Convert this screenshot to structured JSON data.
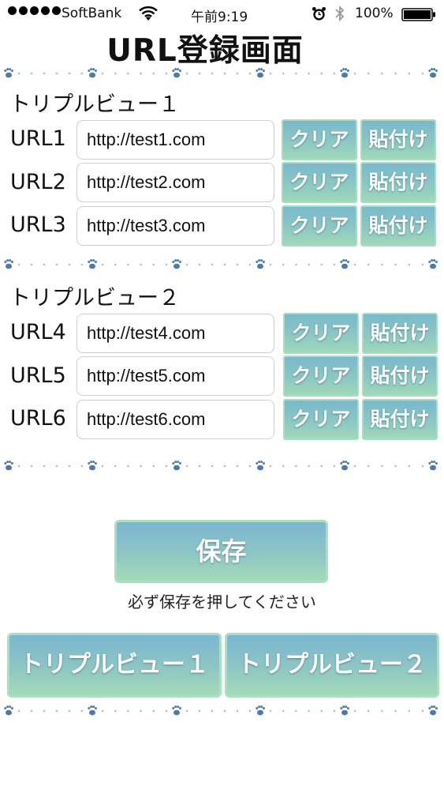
{
  "status_bar": {
    "carrier": "SoftBank",
    "time": "午前9:19",
    "battery_percent": "100%",
    "signal_bars": 5,
    "icons": [
      "wifi-icon",
      "alarm-icon",
      "bluetooth-icon",
      "battery-icon"
    ]
  },
  "page": {
    "title": "URL登録画面"
  },
  "sections": [
    {
      "label": "トリプルビュー１",
      "rows": [
        {
          "label": "URL1",
          "value": "http://test1.com",
          "clear": "クリア",
          "paste": "貼付け"
        },
        {
          "label": "URL2",
          "value": "http://test2.com",
          "clear": "クリア",
          "paste": "貼付け"
        },
        {
          "label": "URL3",
          "value": "http://test3.com",
          "clear": "クリア",
          "paste": "貼付け"
        }
      ]
    },
    {
      "label": "トリプルビュー２",
      "rows": [
        {
          "label": "URL4",
          "value": "http://test4.com",
          "clear": "クリア",
          "paste": "貼付け"
        },
        {
          "label": "URL5",
          "value": "http://test5.com",
          "clear": "クリア",
          "paste": "貼付け"
        },
        {
          "label": "URL6",
          "value": "http://test6.com",
          "clear": "クリア",
          "paste": "貼付け"
        }
      ]
    }
  ],
  "save": {
    "label": "保存",
    "note": "必ず保存を押してください"
  },
  "nav": {
    "view1": "トリプルビュー１",
    "view2": "トリプルビュー２"
  },
  "colors": {
    "button_top": "#78b9cc",
    "button_bottom": "#9fd8b8",
    "paw": "#4a7bb0",
    "dot": "#a9bfd8"
  }
}
